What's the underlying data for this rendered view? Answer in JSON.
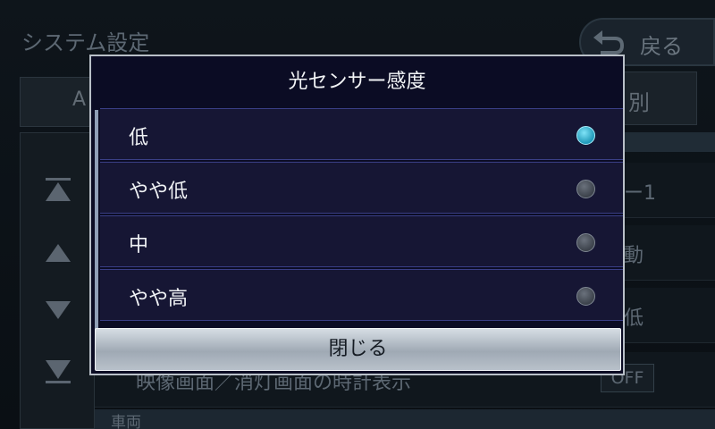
{
  "background": {
    "title": "システム設定",
    "back_label": "戻る",
    "tab_left_label": "A",
    "tab_right_label": "別",
    "rows": [
      {
        "value": "ー1"
      },
      {
        "value": "動"
      },
      {
        "value": "低"
      },
      {
        "label": "映像画面／消灯画面の時計表示",
        "badge": "OFF"
      }
    ],
    "section_label": "車両"
  },
  "dialog": {
    "title": "光センサー感度",
    "options": [
      {
        "label": "低",
        "selected": true
      },
      {
        "label": "やや低",
        "selected": false
      },
      {
        "label": "中",
        "selected": false
      },
      {
        "label": "やや高",
        "selected": false
      }
    ],
    "close_label": "閉じる"
  },
  "colors": {
    "dialog_bg": "#0b0c24",
    "selected_radio": "#1f98b8",
    "option_border": "#3a3f86"
  }
}
